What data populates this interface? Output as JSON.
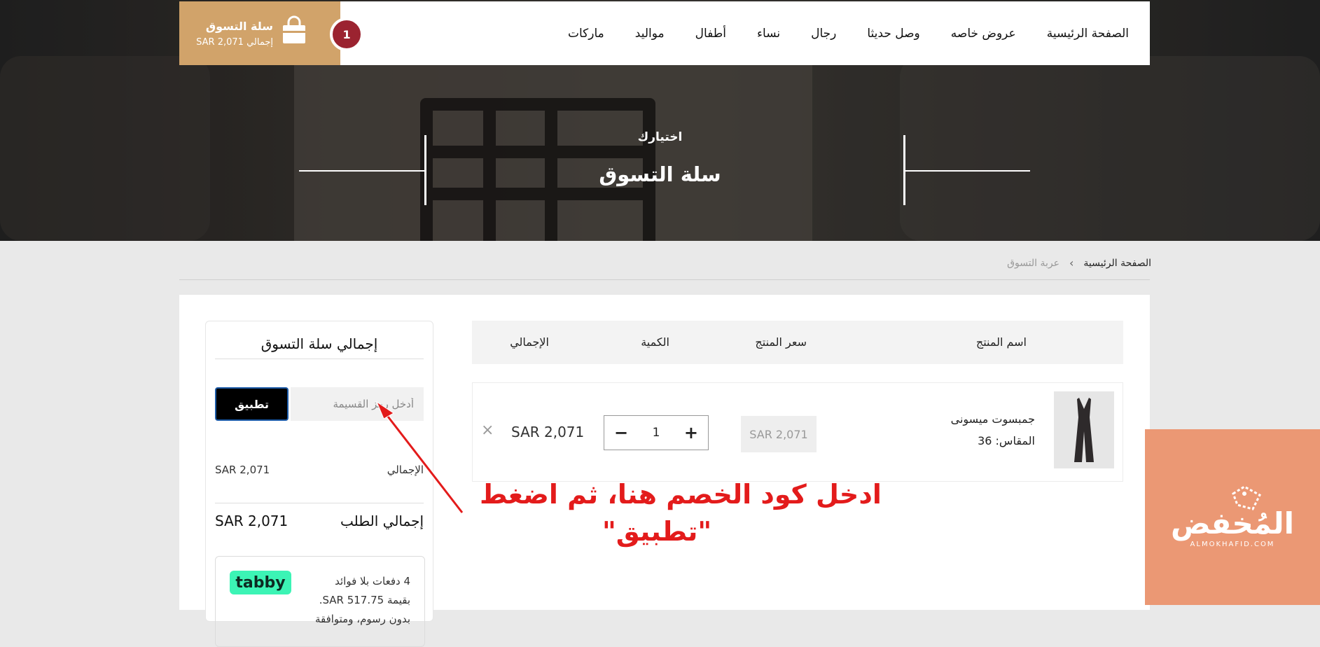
{
  "nav": {
    "links": [
      "الصفحة الرئيسية",
      "عروض خاصه",
      "وصل حديثا",
      "رجال",
      "نساء",
      "أطفال",
      "مواليد",
      "ماركات"
    ]
  },
  "cart_widget": {
    "title": "سلة التسوق",
    "total": "إجمالي SAR 2,071",
    "count": "1",
    "icon": "shopping-bag-icon"
  },
  "hero": {
    "subtitle": "اختيارك",
    "title": "سلة التسوق"
  },
  "breadcrumb": {
    "home": "الصفحة الرئيسية",
    "separator": "›",
    "current": "عربة التسوق"
  },
  "cart_table": {
    "headers": {
      "product_name": "اسم المنتج",
      "product_price": "سعر المنتج",
      "quantity": "الكمية",
      "total": "الإجمالي"
    },
    "items": [
      {
        "name": "جمبسوت ميسونى",
        "size_label": "المقاس:",
        "size_value": "36",
        "price": "SAR 2,071",
        "quantity": "1",
        "total": "SAR 2,071"
      }
    ]
  },
  "summary": {
    "title": "إجمالي سلة التسوق",
    "coupon_placeholder": "أدخل رمز القسيمة",
    "apply_label": "تطبيق",
    "subtotal_label": "الإجمالي",
    "subtotal_value": "SAR 2,071",
    "order_total_label": "إجمالي الطلب",
    "order_total_value": "SAR 2,071"
  },
  "tabby": {
    "logo": "tabby",
    "line1": "4 دفعات بلا فوائد",
    "line2": "بقيمة SAR 517.75.",
    "line3": "بدون رسوم، ومتوافقة"
  },
  "annotation": {
    "line1": "ادخل كود الخصم هنا، ثم اضغط",
    "line2": "\"تطبيق\"",
    "color": "#e31b1b"
  },
  "watermark": {
    "name": "المُخفض",
    "url": "ALMOKHAFID.COM",
    "color": "#eb9874"
  },
  "colors": {
    "cart_widget_bg": "#d1a36a",
    "cart_badge": "#9b2330",
    "tabby_green": "#3cf4b5"
  }
}
